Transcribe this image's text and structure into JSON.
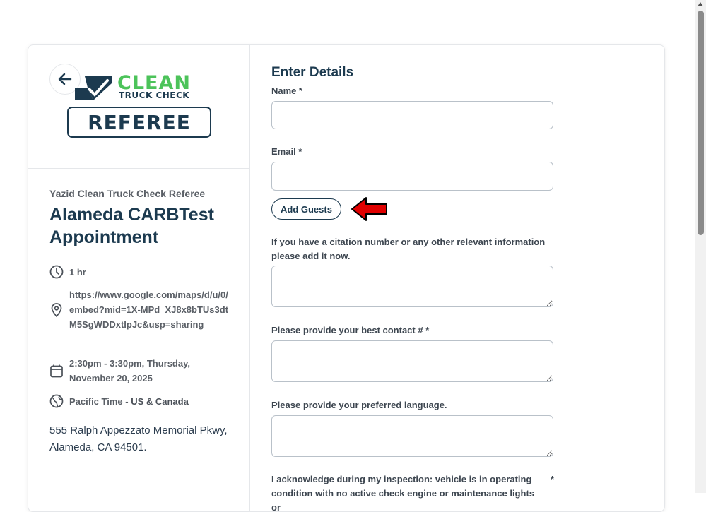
{
  "logo": {
    "word_top": "CLEAN",
    "word_sub": "TRUCK CHECK",
    "word_box": "REFEREE",
    "brand_green": "#4cc35a",
    "brand_navy": "#1c3a4f"
  },
  "event": {
    "host": "Yazid Clean Truck Check Referee",
    "title": "Alameda CARBTest Appointment",
    "duration": "1 hr",
    "location_url": "https://www.google.com/maps/d/u/0/embed?mid=1X-MPd_XJ8x8bTUs3dtM5SgWDDxtlpJc&usp=sharing",
    "datetime": "2:30pm - 3:30pm, Thursday, November 20, 2025",
    "timezone_a": "Pacific Time - ",
    "timezone_b": "US & Canada",
    "address_line1": "555 Ralph Appezzato Memorial Pkwy,",
    "address_line2": "Alameda, CA 94501."
  },
  "form": {
    "heading": "Enter Details",
    "name_label": "Name *",
    "name_value": "",
    "email_label": "Email *",
    "email_value": "",
    "add_guests": "Add Guests",
    "citation_label": "If you have a citation number or any other relevant information please add it now.",
    "contact_label": "Please provide your best contact # *",
    "language_label": "Please provide your preferred language.",
    "acknowledge_label": "I acknowledge during my inspection: vehicle is in operating condition with no active check engine or maintenance lights or",
    "acknowledge_required": "*"
  },
  "icons": {
    "back": "arrow-left-icon",
    "duration": "clock-icon",
    "location": "map-pin-icon",
    "datetime": "calendar-icon",
    "timezone": "globe-icon",
    "annotation": "red-arrow-icon"
  }
}
